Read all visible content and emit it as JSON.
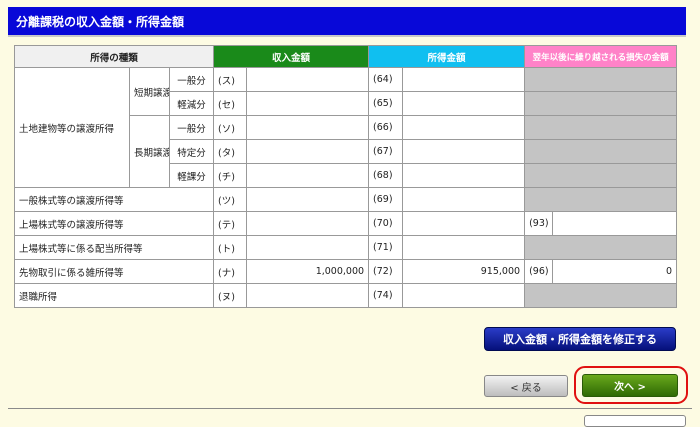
{
  "title": "分離課税の収入金額・所得金額",
  "headers": {
    "kind": "所得の種類",
    "income": "収入金額",
    "profit": "所得金額",
    "loss": "翌年以後に繰り越される損失の金額"
  },
  "land": {
    "label": "土地建物等の譲渡所得",
    "short_label": "短期譲渡",
    "long_label": "長期譲渡",
    "rows": [
      {
        "sub": "一般分",
        "code": "(ス)",
        "pcode": "(64)",
        "income": "",
        "profit": ""
      },
      {
        "sub": "軽減分",
        "code": "(セ)",
        "pcode": "(65)",
        "income": "",
        "profit": ""
      },
      {
        "sub": "一般分",
        "code": "(ソ)",
        "pcode": "(66)",
        "income": "",
        "profit": ""
      },
      {
        "sub": "特定分",
        "code": "(タ)",
        "pcode": "(67)",
        "income": "",
        "profit": ""
      },
      {
        "sub": "軽課分",
        "code": "(チ)",
        "pcode": "(68)",
        "income": "",
        "profit": ""
      }
    ]
  },
  "rows": [
    {
      "label": "一般株式等の譲渡所得等",
      "code": "(ツ)",
      "pcode": "(69)",
      "income": "",
      "profit": ""
    },
    {
      "label": "上場株式等の譲渡所得等",
      "code": "(テ)",
      "pcode": "(70)",
      "income": "",
      "profit": "",
      "lcode": "(93)",
      "loss": ""
    },
    {
      "label": "上場株式等に係る配当所得等",
      "code": "(ト)",
      "pcode": "(71)",
      "income": "",
      "profit": ""
    },
    {
      "label": "先物取引に係る雑所得等",
      "code": "(ナ)",
      "pcode": "(72)",
      "income": "1,000,000",
      "profit": "915,000",
      "lcode": "(96)",
      "loss": "0"
    },
    {
      "label": "退職所得",
      "code": "(ヌ)",
      "pcode": "(74)",
      "income": "",
      "profit": ""
    }
  ],
  "buttons": {
    "fix": "収入金額・所得金額を修正する",
    "back": "< 戻る",
    "next": "次へ >"
  },
  "colors": {
    "title_bg": "#0808d8",
    "income_header": "#1a8a1a",
    "profit_header": "#10bff0",
    "loss_header": "#ff82c8",
    "highlight": "#e01010"
  }
}
